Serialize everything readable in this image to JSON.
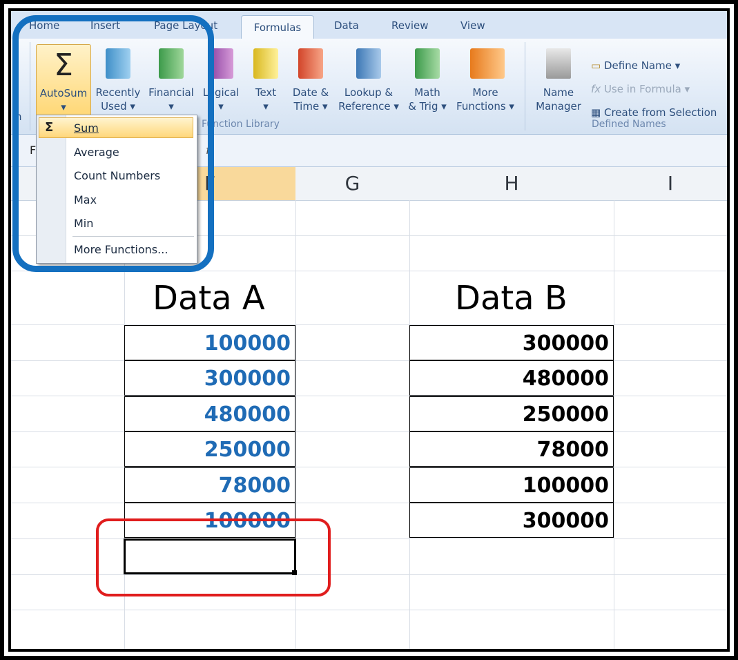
{
  "tabs": [
    "Home",
    "Insert",
    "Page Layout",
    "Formulas",
    "Data",
    "Review",
    "View"
  ],
  "active_tab": "Formulas",
  "ribbon": {
    "partial_left_label": "n",
    "function_library": {
      "buttons": [
        {
          "line1": "AutoSum",
          "line2": "▾"
        },
        {
          "line1": "Recently",
          "line2": "Used ▾"
        },
        {
          "line1": "Financial",
          "line2": "▾"
        },
        {
          "line1": "Logical",
          "line2": "▾"
        },
        {
          "line1": "Text",
          "line2": "▾"
        },
        {
          "line1": "Date &",
          "line2": "Time ▾"
        },
        {
          "line1": "Lookup &",
          "line2": "Reference ▾"
        },
        {
          "line1": "Math",
          "line2": "& Trig ▾"
        },
        {
          "line1": "More",
          "line2": "Functions ▾"
        }
      ],
      "group_label": "Function Library"
    },
    "defined_names": {
      "name_manager_line1": "Name",
      "name_manager_line2": "Manager",
      "define_name": "Define Name ▾",
      "use_in_formula": "Use in Formula ▾",
      "create_from_selection": "Create from Selection",
      "group_label": "Defined Names"
    }
  },
  "formula_bar": {
    "name_box_partial": "F",
    "fx_label": "f"
  },
  "columns": [
    "F",
    "G",
    "H",
    "I"
  ],
  "autosum_menu": {
    "items": [
      "Sum",
      "Average",
      "Count Numbers",
      "Max",
      "Min"
    ],
    "more": "More Functions..."
  },
  "sheet": {
    "data_a_title": "Data A",
    "data_b_title": "Data B",
    "data_a": [
      "100000",
      "300000",
      "480000",
      "250000",
      "78000",
      "100000"
    ],
    "data_b": [
      "300000",
      "480000",
      "250000",
      "78000",
      "100000",
      "300000"
    ]
  },
  "colors": {
    "highlight_blue": "#1470c0",
    "highlight_red": "#e01d1d",
    "data_a_text": "#1f6bb5"
  }
}
